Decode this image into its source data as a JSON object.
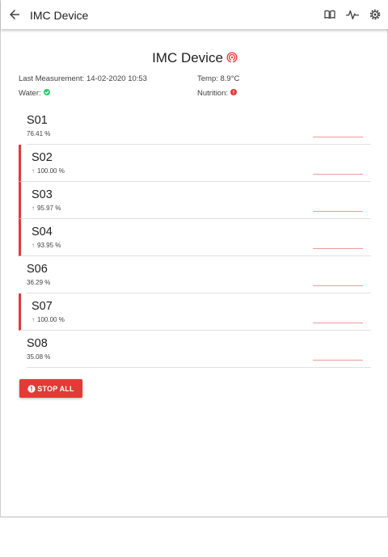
{
  "appbar": {
    "title": "IMC Device",
    "icons": [
      "back-arrow-icon",
      "book-icon",
      "activity-icon",
      "settings-icon"
    ]
  },
  "header": {
    "title": "IMC Device",
    "icon": "wifi-icon"
  },
  "info": {
    "last_measurement_label": "Last Measurement: 14-02-2020 10:53",
    "temp_label": "Temp: 8.9°C",
    "water_label": "Water:",
    "water_status": "ok",
    "water_status_color": "#2ecc71",
    "nutrition_label": "Nutrition:",
    "nutrition_status": "error",
    "nutrition_status_color": "#e53935"
  },
  "sensors": [
    {
      "name": "S01",
      "value": "76.41 %",
      "alert": false
    },
    {
      "name": "S02",
      "value": "100.00 %",
      "alert": true
    },
    {
      "name": "S03",
      "value": "95.97 %",
      "alert": true
    },
    {
      "name": "S04",
      "value": "93.95 %",
      "alert": true
    },
    {
      "name": "S06",
      "value": "36.29 %",
      "alert": false
    },
    {
      "name": "S07",
      "value": "100.00 %",
      "alert": true
    },
    {
      "name": "S08",
      "value": "35.08 %",
      "alert": false
    }
  ],
  "stop_button": {
    "label": "STOP ALL"
  },
  "colors": {
    "accent": "#e53935",
    "ok": "#2ecc71"
  }
}
